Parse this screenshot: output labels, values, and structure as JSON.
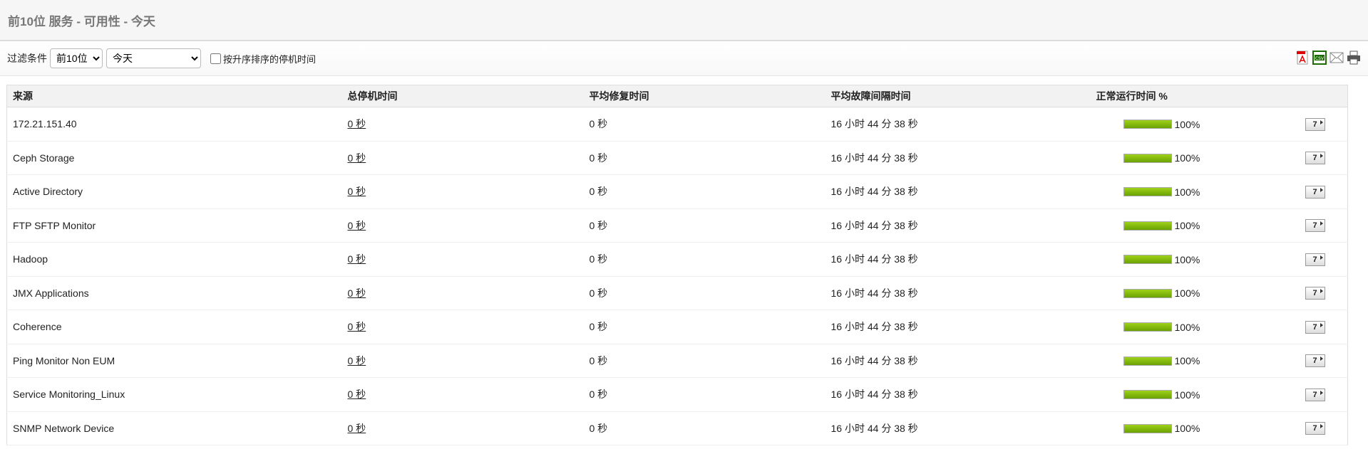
{
  "header": {
    "title": "前10位 服务 - 可用性 - 今天"
  },
  "filter": {
    "label": "过滤条件",
    "top_selected": "前10位",
    "period_selected": "今天",
    "checkbox_label": "按升序排序的停机时间",
    "checkbox_checked": false
  },
  "export_icons": [
    "pdf-icon",
    "csv-icon",
    "email-icon",
    "print-icon"
  ],
  "table": {
    "columns": [
      "来源",
      "总停机时间",
      "平均修复时间",
      "平均故障间隔时间",
      "正常运行时间 %"
    ],
    "rows": [
      {
        "source": "172.21.151.40",
        "downtime": "0 秒",
        "mttr": "0 秒",
        "mtbf": "16 小时 44 分 38 秒",
        "uptime": "100%",
        "uptime_value": 100,
        "action": "7"
      },
      {
        "source": "Ceph Storage",
        "downtime": "0 秒",
        "mttr": "0 秒",
        "mtbf": "16 小时 44 分 38 秒",
        "uptime": "100%",
        "uptime_value": 100,
        "action": "7"
      },
      {
        "source": "Active Directory",
        "downtime": "0 秒",
        "mttr": "0 秒",
        "mtbf": "16 小时 44 分 38 秒",
        "uptime": "100%",
        "uptime_value": 100,
        "action": "7"
      },
      {
        "source": "FTP SFTP Monitor",
        "downtime": "0 秒",
        "mttr": "0 秒",
        "mtbf": "16 小时 44 分 38 秒",
        "uptime": "100%",
        "uptime_value": 100,
        "action": "7"
      },
      {
        "source": "Hadoop",
        "downtime": "0 秒",
        "mttr": "0 秒",
        "mtbf": "16 小时 44 分 38 秒",
        "uptime": "100%",
        "uptime_value": 100,
        "action": "7"
      },
      {
        "source": "JMX Applications",
        "downtime": "0 秒",
        "mttr": "0 秒",
        "mtbf": "16 小时 44 分 38 秒",
        "uptime": "100%",
        "uptime_value": 100,
        "action": "7"
      },
      {
        "source": "Coherence",
        "downtime": "0 秒",
        "mttr": "0 秒",
        "mtbf": "16 小时 44 分 38 秒",
        "uptime": "100%",
        "uptime_value": 100,
        "action": "7"
      },
      {
        "source": "Ping Monitor Non EUM",
        "downtime": "0 秒",
        "mttr": "0 秒",
        "mtbf": "16 小时 44 分 38 秒",
        "uptime": "100%",
        "uptime_value": 100,
        "action": "7"
      },
      {
        "source": "Service Monitoring_Linux",
        "downtime": "0 秒",
        "mttr": "0 秒",
        "mtbf": "16 小时 44 分 38 秒",
        "uptime": "100%",
        "uptime_value": 100,
        "action": "7"
      },
      {
        "source": "SNMP Network Device",
        "downtime": "0 秒",
        "mttr": "0 秒",
        "mtbf": "16 小时 44 分 38 秒",
        "uptime": "100%",
        "uptime_value": 100,
        "action": "7"
      }
    ]
  }
}
